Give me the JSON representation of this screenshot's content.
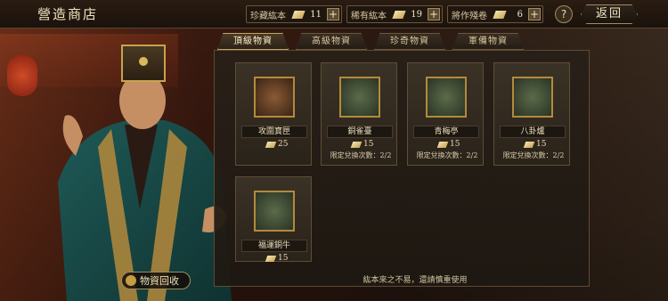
{
  "header": {
    "title": "營造商店",
    "back_label": "返回",
    "help_label": "?"
  },
  "resources": [
    {
      "label": "珍藏紘本",
      "value": "11",
      "plus": "+"
    },
    {
      "label": "稀有紘本",
      "value": "19",
      "plus": "+"
    },
    {
      "label": "將作殘卷",
      "value": "6",
      "plus": "+"
    }
  ],
  "tabs": [
    {
      "label": "頂級物資",
      "active": true
    },
    {
      "label": "高級物資",
      "active": false
    },
    {
      "label": "珍奇物資",
      "active": false
    },
    {
      "label": "軍備物資",
      "active": false
    }
  ],
  "items": [
    {
      "name": "攻圍寶匣",
      "price": "25",
      "limit": ""
    },
    {
      "name": "銅雀臺",
      "price": "15",
      "limit": "限定兌換次數：2/2"
    },
    {
      "name": "青梅亭",
      "price": "15",
      "limit": "限定兌換次數：2/2"
    },
    {
      "name": "八卦爐",
      "price": "15",
      "limit": "限定兌換次數：2/2"
    },
    {
      "name": "福運銅牛",
      "price": "15",
      "limit": ""
    }
  ],
  "recycle_label": "物資回收",
  "notice": "紘本來之不易，還請慎重使用",
  "colors": {
    "accent": "#c2a266",
    "panel": "#2a231a"
  }
}
